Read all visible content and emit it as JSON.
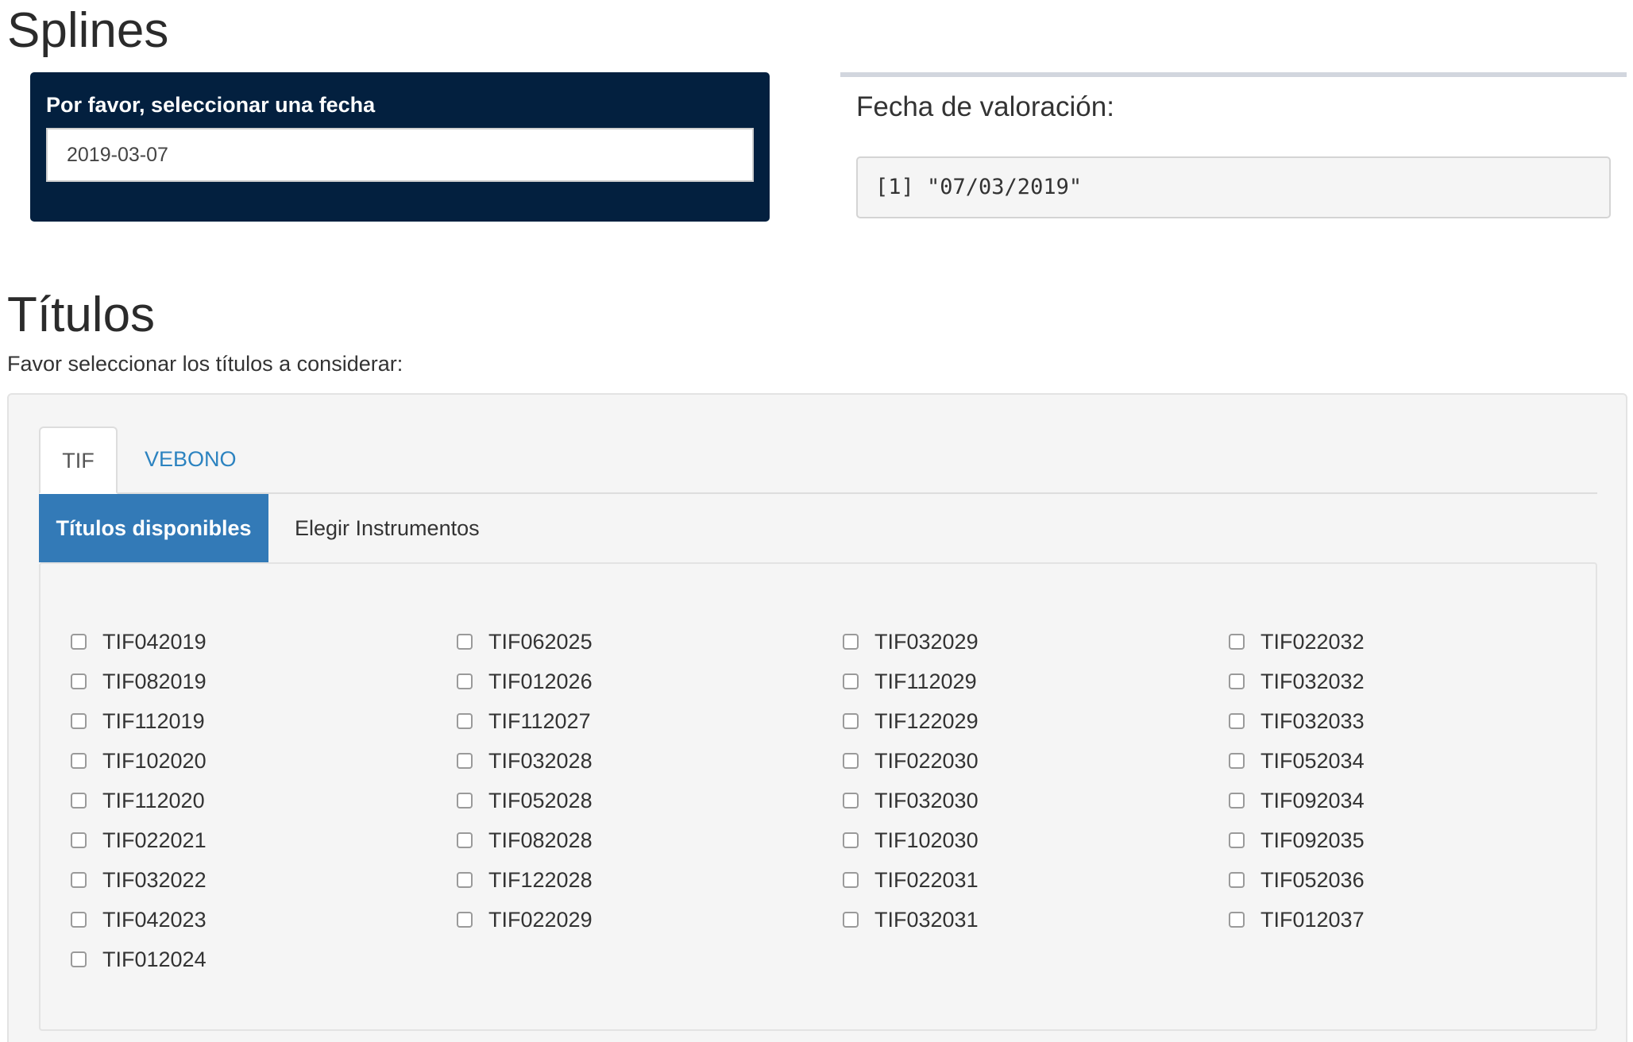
{
  "splines": {
    "title": "Splines",
    "date_label": "Por favor, seleccionar una fecha",
    "date_value": "2019-03-07"
  },
  "valoracion": {
    "label": "Fecha de valoración:",
    "output": "[1] \"07/03/2019\""
  },
  "titulos": {
    "title": "Títulos",
    "subtitle": "Favor seleccionar los títulos a considerar:",
    "tabs": [
      {
        "label": "TIF",
        "active": true
      },
      {
        "label": "VEBONO",
        "active": false
      }
    ],
    "pills": [
      {
        "label": "Títulos disponibles",
        "active": true
      },
      {
        "label": "Elegir Instrumentos",
        "active": false
      }
    ],
    "columns": [
      [
        "TIF042019",
        "TIF082019",
        "TIF112019",
        "TIF102020",
        "TIF112020",
        "TIF022021",
        "TIF032022",
        "TIF042023",
        "TIF012024"
      ],
      [
        "TIF062025",
        "TIF012026",
        "TIF112027",
        "TIF032028",
        "TIF052028",
        "TIF082028",
        "TIF122028",
        "TIF022029"
      ],
      [
        "TIF032029",
        "TIF112029",
        "TIF122029",
        "TIF022030",
        "TIF032030",
        "TIF102030",
        "TIF022031",
        "TIF032031"
      ],
      [
        "TIF022032",
        "TIF032032",
        "TIF032033",
        "TIF052034",
        "TIF092034",
        "TIF092035",
        "TIF052036",
        "TIF012037"
      ]
    ]
  }
}
